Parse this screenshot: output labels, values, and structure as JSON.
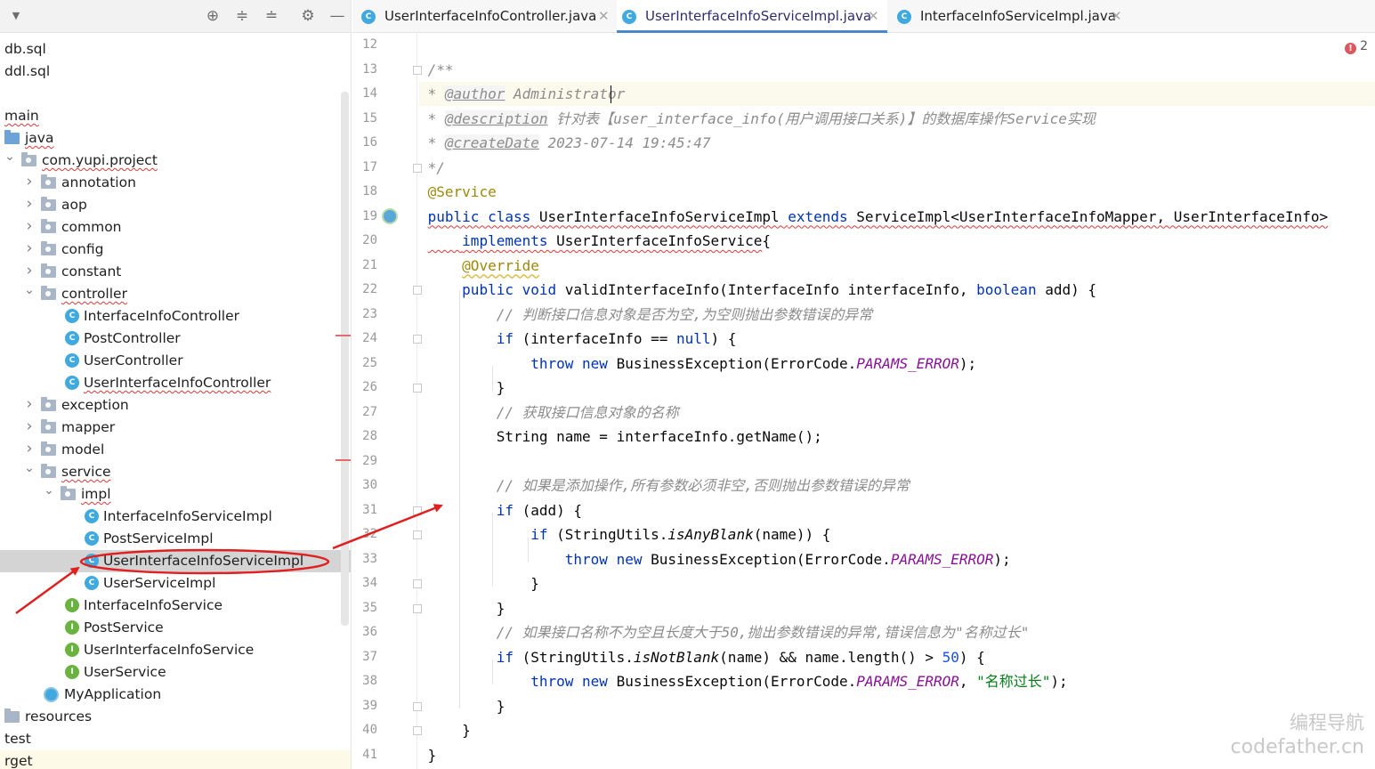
{
  "project_tree": [
    {
      "label": "db.sql",
      "kind": "file",
      "depth": 0
    },
    {
      "label": "ddl.sql",
      "kind": "file",
      "depth": 0
    },
    {
      "label": "",
      "kind": "file",
      "depth": 0
    },
    {
      "label": "main",
      "kind": "text",
      "depth": 0
    },
    {
      "label": "java",
      "kind": "src-folder",
      "depth": 0
    },
    {
      "label": "com.yupi.project",
      "kind": "package",
      "depth": 1,
      "expanded": true
    },
    {
      "label": "annotation",
      "kind": "package",
      "depth": 2,
      "expanded": false
    },
    {
      "label": "aop",
      "kind": "package",
      "depth": 2,
      "expanded": false
    },
    {
      "label": "common",
      "kind": "package",
      "depth": 2,
      "expanded": false
    },
    {
      "label": "config",
      "kind": "package",
      "depth": 2,
      "expanded": false
    },
    {
      "label": "constant",
      "kind": "package",
      "depth": 2,
      "expanded": false
    },
    {
      "label": "controller",
      "kind": "package",
      "depth": 2,
      "expanded": true
    },
    {
      "label": "InterfaceInfoController",
      "kind": "class",
      "depth": 3
    },
    {
      "label": "PostController",
      "kind": "class",
      "depth": 3
    },
    {
      "label": "UserController",
      "kind": "class",
      "depth": 3
    },
    {
      "label": "UserInterfaceInfoController",
      "kind": "class",
      "depth": 3
    },
    {
      "label": "exception",
      "kind": "package",
      "depth": 2,
      "expanded": false
    },
    {
      "label": "mapper",
      "kind": "package",
      "depth": 2,
      "expanded": false
    },
    {
      "label": "model",
      "kind": "package",
      "depth": 2,
      "expanded": false
    },
    {
      "label": "service",
      "kind": "package",
      "depth": 2,
      "expanded": true
    },
    {
      "label": "impl",
      "kind": "package",
      "depth": 3,
      "expanded": true
    },
    {
      "label": "InterfaceInfoServiceImpl",
      "kind": "class",
      "depth": 4
    },
    {
      "label": "PostServiceImpl",
      "kind": "class",
      "depth": 4
    },
    {
      "label": "UserInterfaceInfoServiceImpl",
      "kind": "class",
      "depth": 4,
      "selected": true
    },
    {
      "label": "UserServiceImpl",
      "kind": "class",
      "depth": 4
    },
    {
      "label": "InterfaceInfoService",
      "kind": "interface",
      "depth": 3
    },
    {
      "label": "PostService",
      "kind": "interface",
      "depth": 3
    },
    {
      "label": "UserInterfaceInfoService",
      "kind": "interface",
      "depth": 3
    },
    {
      "label": "UserService",
      "kind": "interface",
      "depth": 3
    },
    {
      "label": "MyApplication",
      "kind": "app",
      "depth": 2
    },
    {
      "label": "resources",
      "kind": "folder-top",
      "depth": 0
    },
    {
      "label": "test",
      "kind": "text",
      "depth": 0
    },
    {
      "label": "rget",
      "kind": "text-hl",
      "depth": 0
    }
  ],
  "tabs": [
    {
      "label": "UserInterfaceInfoController.java",
      "active": false
    },
    {
      "label": "UserInterfaceInfoServiceImpl.java",
      "active": true
    },
    {
      "label": "InterfaceInfoServiceImpl.java",
      "active": false
    }
  ],
  "close_glyph": "✕",
  "inspection": {
    "error_count": "2"
  },
  "code_lines": [
    {
      "n": "12",
      "parts": []
    },
    {
      "n": "13",
      "parts": [
        [
          "cm",
          "/**"
        ]
      ]
    },
    {
      "n": "14",
      "parts": [
        [
          "cm",
          "* "
        ],
        [
          "tag",
          "@author"
        ],
        [
          "cm",
          " Administrator"
        ]
      ],
      "current": true
    },
    {
      "n": "15",
      "parts": [
        [
          "cm",
          "* "
        ],
        [
          "tag",
          "@description"
        ],
        [
          "cm",
          " 针对表【user_interface_info(用户调用接口关系)】的数据库操作Service实现"
        ]
      ]
    },
    {
      "n": "16",
      "parts": [
        [
          "cm",
          "* "
        ],
        [
          "tag",
          "@createDate"
        ],
        [
          "tagd",
          " 2023-07-14 19:45:47"
        ]
      ]
    },
    {
      "n": "17",
      "parts": [
        [
          "cm",
          "*/"
        ]
      ]
    },
    {
      "n": "18",
      "parts": [
        [
          "ann",
          "@Service"
        ]
      ]
    },
    {
      "n": "19",
      "parts": [
        [
          "kw u",
          "public class "
        ],
        [
          "u",
          "UserInterfaceInfoServiceImpl "
        ],
        [
          "kw u",
          "extends "
        ],
        [
          "u",
          "ServiceImpl<UserInterfaceInfoMapper, UserInterfaceInfo>"
        ]
      ]
    },
    {
      "n": "20",
      "parts": [
        [
          "u",
          "    "
        ],
        [
          "kw u",
          "implements "
        ],
        [
          "u",
          "UserInterfaceInfoService"
        ],
        [
          "",
          "{"
        ]
      ]
    },
    {
      "n": "21",
      "parts": [
        [
          "",
          "    "
        ],
        [
          "ovr",
          "@Override"
        ]
      ]
    },
    {
      "n": "22",
      "parts": [
        [
          "",
          "    "
        ],
        [
          "kw",
          "public void "
        ],
        [
          "",
          "validInterfaceInfo(InterfaceInfo interfaceInfo, "
        ],
        [
          "kw",
          "boolean "
        ],
        [
          "",
          "add) {"
        ]
      ]
    },
    {
      "n": "23",
      "parts": [
        [
          "",
          "        "
        ],
        [
          "cm",
          "// 判断接口信息对象是否为空,为空则抛出参数错误的异常"
        ]
      ]
    },
    {
      "n": "24",
      "parts": [
        [
          "",
          "        "
        ],
        [
          "kw",
          "if "
        ],
        [
          "",
          "(interfaceInfo == "
        ],
        [
          "kw",
          "null"
        ],
        [
          "",
          ") {"
        ]
      ]
    },
    {
      "n": "25",
      "parts": [
        [
          "",
          "            "
        ],
        [
          "kw",
          "throw new "
        ],
        [
          "",
          "BusinessException(ErrorCode."
        ],
        [
          "st",
          "PARAMS_ERROR"
        ],
        [
          "",
          ");"
        ]
      ]
    },
    {
      "n": "26",
      "parts": [
        [
          "",
          "        }"
        ]
      ]
    },
    {
      "n": "27",
      "parts": [
        [
          "",
          "        "
        ],
        [
          "cm",
          "// 获取接口信息对象的名称"
        ]
      ]
    },
    {
      "n": "28",
      "parts": [
        [
          "",
          "        String name = interfaceInfo.getName();"
        ]
      ]
    },
    {
      "n": "29",
      "parts": []
    },
    {
      "n": "30",
      "parts": [
        [
          "",
          "        "
        ],
        [
          "cm",
          "// 如果是添加操作,所有参数必须非空,否则抛出参数错误的异常"
        ]
      ]
    },
    {
      "n": "31",
      "parts": [
        [
          "",
          "        "
        ],
        [
          "kw",
          "if "
        ],
        [
          "",
          "(add) {"
        ]
      ]
    },
    {
      "n": "32",
      "parts": [
        [
          "",
          "            "
        ],
        [
          "kw",
          "if "
        ],
        [
          "",
          "(StringUtils."
        ],
        [
          "mi",
          "isAnyBlank"
        ],
        [
          "",
          "(name)) {"
        ]
      ]
    },
    {
      "n": "33",
      "parts": [
        [
          "",
          "                "
        ],
        [
          "kw",
          "throw new "
        ],
        [
          "",
          "BusinessException(ErrorCode."
        ],
        [
          "st",
          "PARAMS_ERROR"
        ],
        [
          "",
          ");"
        ]
      ]
    },
    {
      "n": "34",
      "parts": [
        [
          "",
          "            }"
        ]
      ]
    },
    {
      "n": "35",
      "parts": [
        [
          "",
          "        }"
        ]
      ]
    },
    {
      "n": "36",
      "parts": [
        [
          "",
          "        "
        ],
        [
          "cm",
          "// 如果接口名称不为空且长度大于50,抛出参数错误的异常,错误信息为\"名称过长\""
        ]
      ]
    },
    {
      "n": "37",
      "parts": [
        [
          "",
          "        "
        ],
        [
          "kw",
          "if "
        ],
        [
          "",
          "(StringUtils."
        ],
        [
          "mi",
          "isNotBlank"
        ],
        [
          "",
          "(name) && name.length() > "
        ],
        [
          "num",
          "50"
        ],
        [
          "",
          ") {"
        ]
      ]
    },
    {
      "n": "38",
      "parts": [
        [
          "",
          "            "
        ],
        [
          "kw",
          "throw new "
        ],
        [
          "",
          "BusinessException(ErrorCode."
        ],
        [
          "st",
          "PARAMS_ERROR"
        ],
        [
          "",
          ", "
        ],
        [
          "str",
          "\"名称过长\""
        ],
        [
          "",
          ");"
        ]
      ]
    },
    {
      "n": "39",
      "parts": [
        [
          "",
          "        }"
        ]
      ]
    },
    {
      "n": "40",
      "parts": [
        [
          "",
          "    }"
        ]
      ]
    },
    {
      "n": "41",
      "parts": [
        [
          "",
          "}"
        ]
      ]
    }
  ],
  "watermark": {
    "line1": "编程导航",
    "line2": "codefather.cn"
  },
  "colors": {
    "accent": "#4a88c7",
    "annotation_red": "#e02020",
    "selection": "#d4d4d4"
  }
}
